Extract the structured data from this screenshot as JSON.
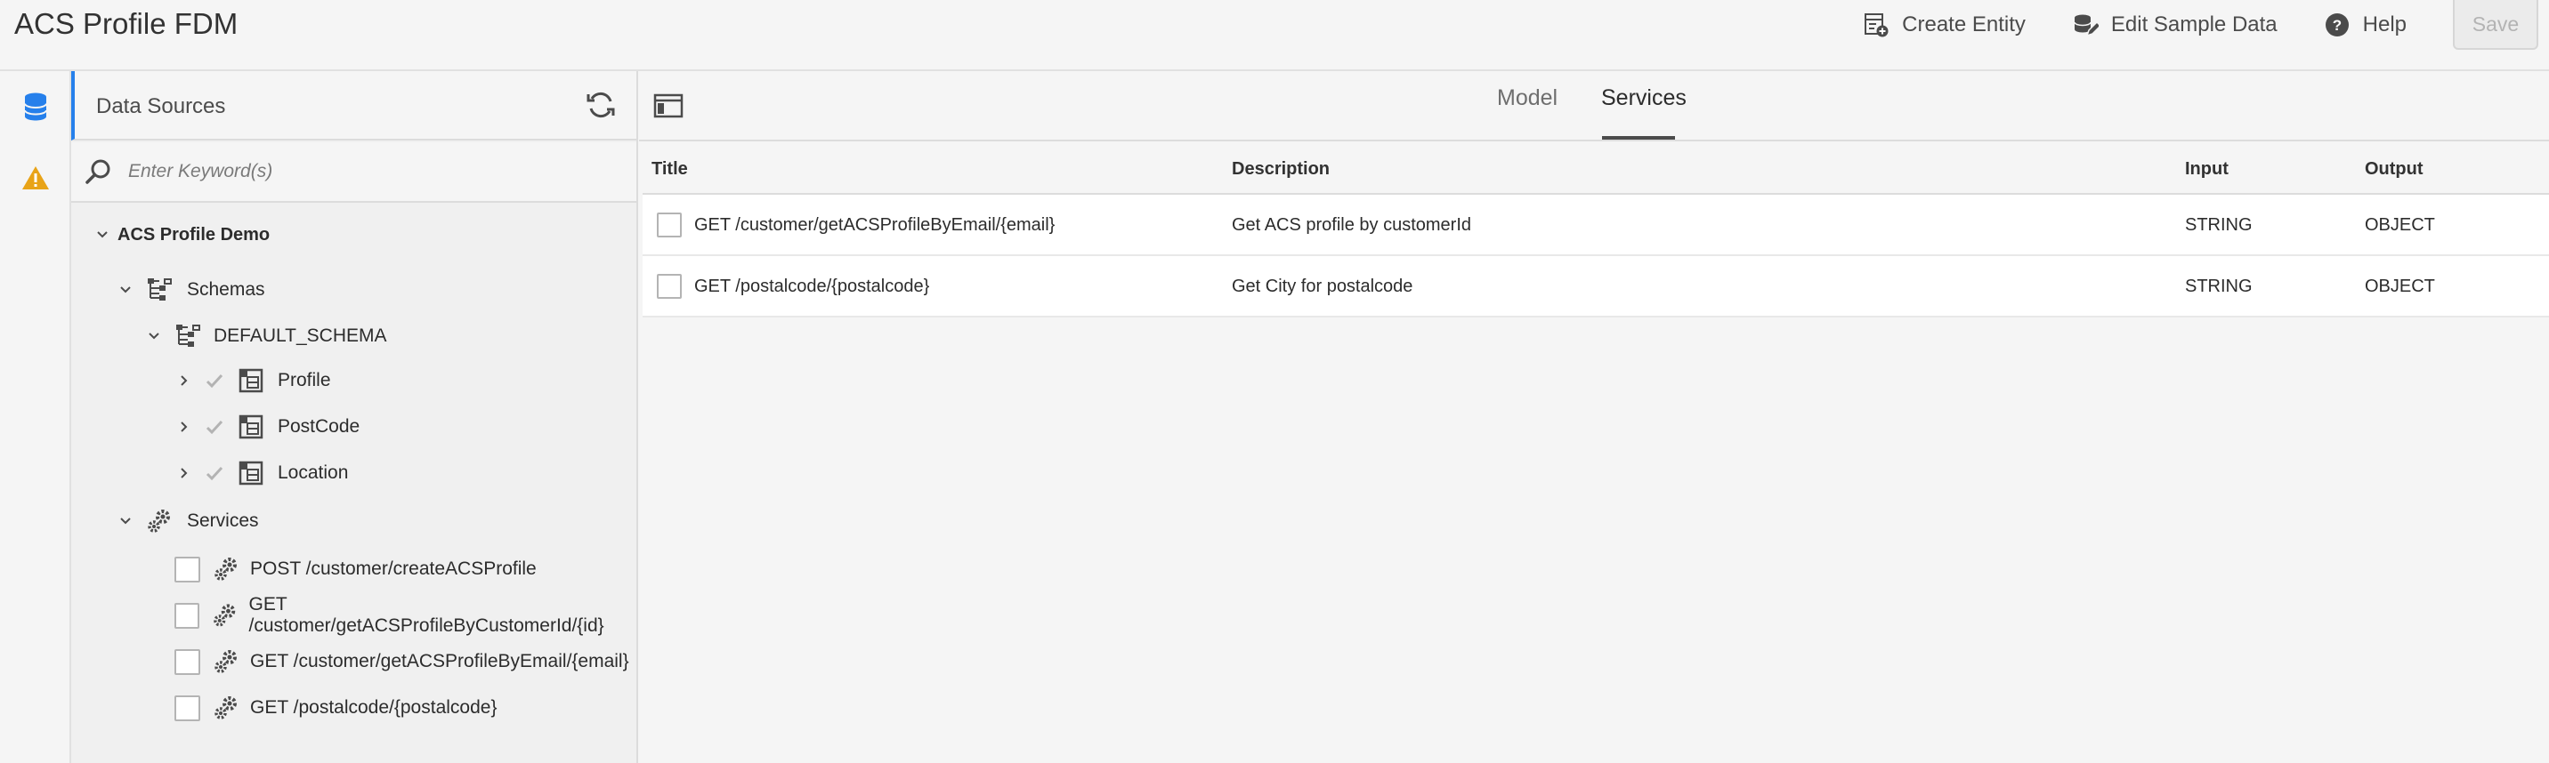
{
  "app": {
    "title": "ACS Profile FDM"
  },
  "toolbar": {
    "create_entity": "Create Entity",
    "edit_sample_data": "Edit Sample Data",
    "help": "Help",
    "save": "Save"
  },
  "rail": {
    "items": [
      "database-icon",
      "alert-icon"
    ]
  },
  "data_sources": {
    "title": "Data Sources",
    "search_placeholder": "Enter Keyword(s)",
    "tree": {
      "root": "ACS Profile Demo",
      "schemas_label": "Schemas",
      "schema_name": "DEFAULT_SCHEMA",
      "entities": [
        "Profile",
        "PostCode",
        "Location"
      ],
      "services_label": "Services",
      "services": [
        "POST /customer/createACSProfile",
        "GET /customer/getACSProfileByCustomerId/{id}",
        "GET /customer/getACSProfileByEmail/{email}",
        "GET /postalcode/{postalcode}"
      ]
    }
  },
  "tabs": {
    "model": "Model",
    "services": "Services",
    "active": "Services"
  },
  "table": {
    "headers": {
      "title": "Title",
      "description": "Description",
      "input": "Input",
      "output": "Output"
    },
    "rows": [
      {
        "title": "GET /customer/getACSProfileByEmail/{email}",
        "description": "Get ACS profile by customerId",
        "input": "STRING",
        "output": "OBJECT"
      },
      {
        "title": "GET /postalcode/{postalcode}",
        "description": "Get City for postalcode",
        "input": "STRING",
        "output": "OBJECT"
      }
    ]
  },
  "colors": {
    "accent": "#2680eb",
    "warning": "#e8a317",
    "text": "#2c2c2c",
    "muted": "#6e6e6e"
  }
}
